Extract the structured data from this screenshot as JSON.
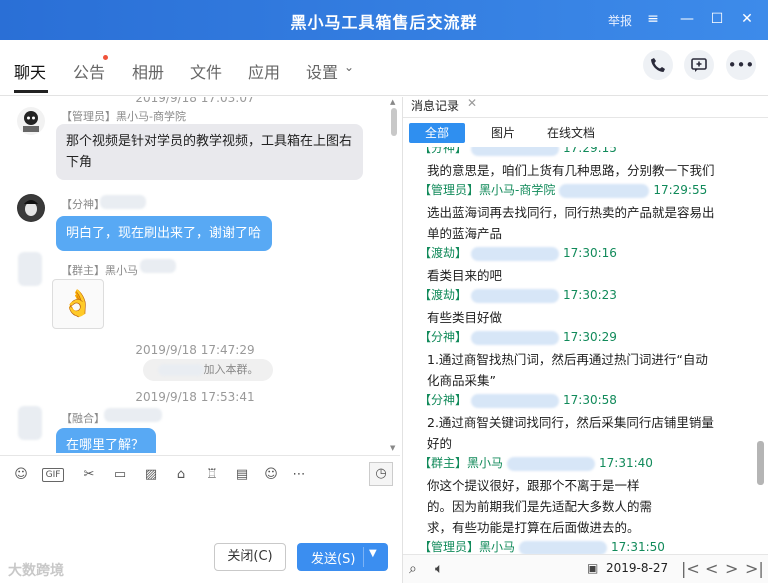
{
  "window": {
    "title": "黑小马工具箱售后交流群",
    "report_label": "举报",
    "buttons": {
      "minimize": "—",
      "restore": "☐",
      "close": "✕",
      "menu": "≡"
    }
  },
  "tabs": [
    "聊天",
    "公告",
    "相册",
    "文件",
    "应用",
    "设置"
  ],
  "chat": {
    "messages": [
      {
        "time": "2019/9/18 17:03:07",
        "sender": "【管理员】黑小马-商学院",
        "text_line1": "那个视频是针对学员的教学视频，工具箱在上图右",
        "text_line2": "下角"
      },
      {
        "sender": "【分神】",
        "text": "明白了，现在刷出来了，谢谢了哈"
      },
      {
        "sender": "【群主】黑小马",
        "emoji": "👌"
      },
      {
        "time": "2019/9/18 17:47:29",
        "notice": "加入本群。"
      },
      {
        "time": "2019/9/18 17:53:41",
        "sender": "【融合】",
        "text": "在哪里了解？"
      }
    ]
  },
  "composer": {
    "gif_label": "GIF",
    "close_label": "关闭(C)",
    "send_label": "发送(S)"
  },
  "watermark": "大数跨境",
  "history": {
    "tab_label": "消息记录",
    "filters": [
      "全部",
      "图片",
      "在线文档"
    ],
    "entries": [
      {
        "type": "head",
        "sender": "【分神】",
        "time": "17:29:15"
      },
      {
        "type": "msg",
        "text": "我的意思是，咱们上货有几种思路，分别教一下我们"
      },
      {
        "type": "head",
        "sender": "【管理员】黑小马-商学院",
        "time": "17:29:55"
      },
      {
        "type": "msg",
        "text": "选出蓝海词再去找同行，同行热卖的产品就是容易出"
      },
      {
        "type": "msg",
        "text": "单的蓝海产品"
      },
      {
        "type": "head",
        "sender": "【渡劫】",
        "time": "17:30:16"
      },
      {
        "type": "msg",
        "text": "看类目来的吧"
      },
      {
        "type": "head",
        "sender": "【渡劫】",
        "time": "17:30:23"
      },
      {
        "type": "msg",
        "text": "有些类目好做"
      },
      {
        "type": "head",
        "sender": "【分神】",
        "time": "17:30:29"
      },
      {
        "type": "msg",
        "text": "1.通过商智找热门词，然后再通过热门词进行“自动"
      },
      {
        "type": "msg",
        "text": "化商品采集”"
      },
      {
        "type": "head",
        "sender": "【分神】",
        "time": "17:30:58"
      },
      {
        "type": "msg",
        "text": "2.通过商智关键词找同行，然后采集同行店铺里销量"
      },
      {
        "type": "msg",
        "text": "好的"
      },
      {
        "type": "head",
        "sender": "【群主】黑小马",
        "time": "17:31:40"
      },
      {
        "type": "msg",
        "text": "你这个提议很好，跟那个不离于是一样"
      },
      {
        "type": "msg",
        "text": "的。因为前期我们是先适配大多数人的需"
      },
      {
        "type": "msg",
        "text": "求，有些功能是打算在后面做进去的。"
      },
      {
        "type": "head",
        "sender": "【管理员】黑小马",
        "time": "17:31:50"
      }
    ],
    "date": "2019-8-27"
  }
}
